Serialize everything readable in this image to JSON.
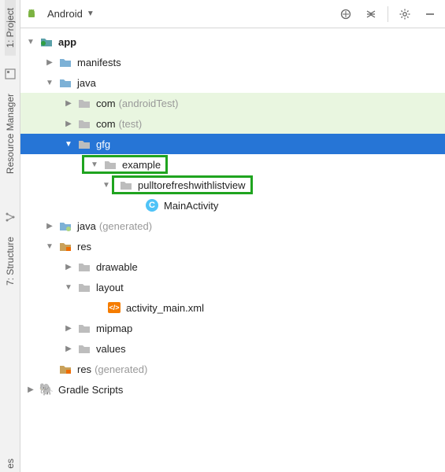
{
  "header": {
    "dropdown_label": "Android"
  },
  "sidebar_tabs": {
    "project": "1: Project",
    "resource_manager": "Resource Manager",
    "structure": "7: Structure",
    "es": "es"
  },
  "tree": {
    "app": "app",
    "manifests": "manifests",
    "java": "java",
    "com1": {
      "name": "com",
      "suffix": "(androidTest)"
    },
    "com2": {
      "name": "com",
      "suffix": "(test)"
    },
    "gfg": "gfg",
    "example": "example",
    "pulltorefresh": "pulltorefreshwithlistview",
    "main_activity": "MainActivity",
    "java_gen": {
      "name": "java",
      "suffix": "(generated)"
    },
    "res": "res",
    "drawable": "drawable",
    "layout": "layout",
    "activity_main": "activity_main.xml",
    "mipmap": "mipmap",
    "values": "values",
    "res_gen": {
      "name": "res",
      "suffix": "(generated)"
    },
    "gradle_scripts": "Gradle Scripts"
  },
  "icons": {
    "class_letter": "C",
    "xml_label": "</>"
  }
}
